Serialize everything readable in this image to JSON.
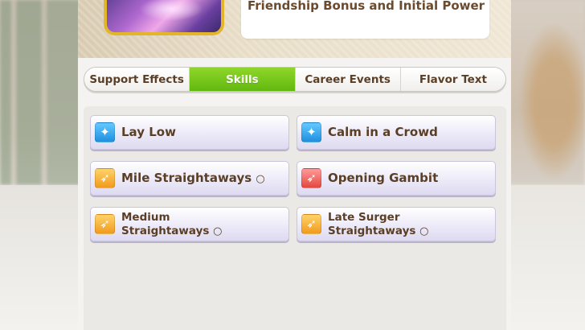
{
  "header": {
    "title": "Friendship Bonus and Initial Power"
  },
  "tabs": [
    {
      "label": "Support Effects",
      "active": false
    },
    {
      "label": "Skills",
      "active": true
    },
    {
      "label": "Career Events",
      "active": false
    },
    {
      "label": "Flavor Text",
      "active": false
    }
  ],
  "skills": [
    {
      "line1": "Lay Low",
      "line2": "",
      "mark": "",
      "icon": "sparkle-icon",
      "icon_color": "blue"
    },
    {
      "line1": "Calm in a Crowd",
      "line2": "",
      "mark": "",
      "icon": "sparkle-icon",
      "icon_color": "blue"
    },
    {
      "line1": "Mile Straightaways",
      "line2": "",
      "mark": "○",
      "icon": "runner-icon",
      "icon_color": "orange"
    },
    {
      "line1": "Opening Gambit",
      "line2": "",
      "mark": "",
      "icon": "runner-icon",
      "icon_color": "red"
    },
    {
      "line1": "Medium",
      "line2": "Straightaways",
      "mark": "○",
      "icon": "runner-icon",
      "icon_color": "orange"
    },
    {
      "line1": "Late Surger",
      "line2": "Straightaways",
      "mark": "○",
      "icon": "runner-icon",
      "icon_color": "orange"
    }
  ],
  "colors": {
    "active_tab": "#62b80f",
    "text_brown": "#5a3e25",
    "frame_gold": "#e2b52a"
  }
}
